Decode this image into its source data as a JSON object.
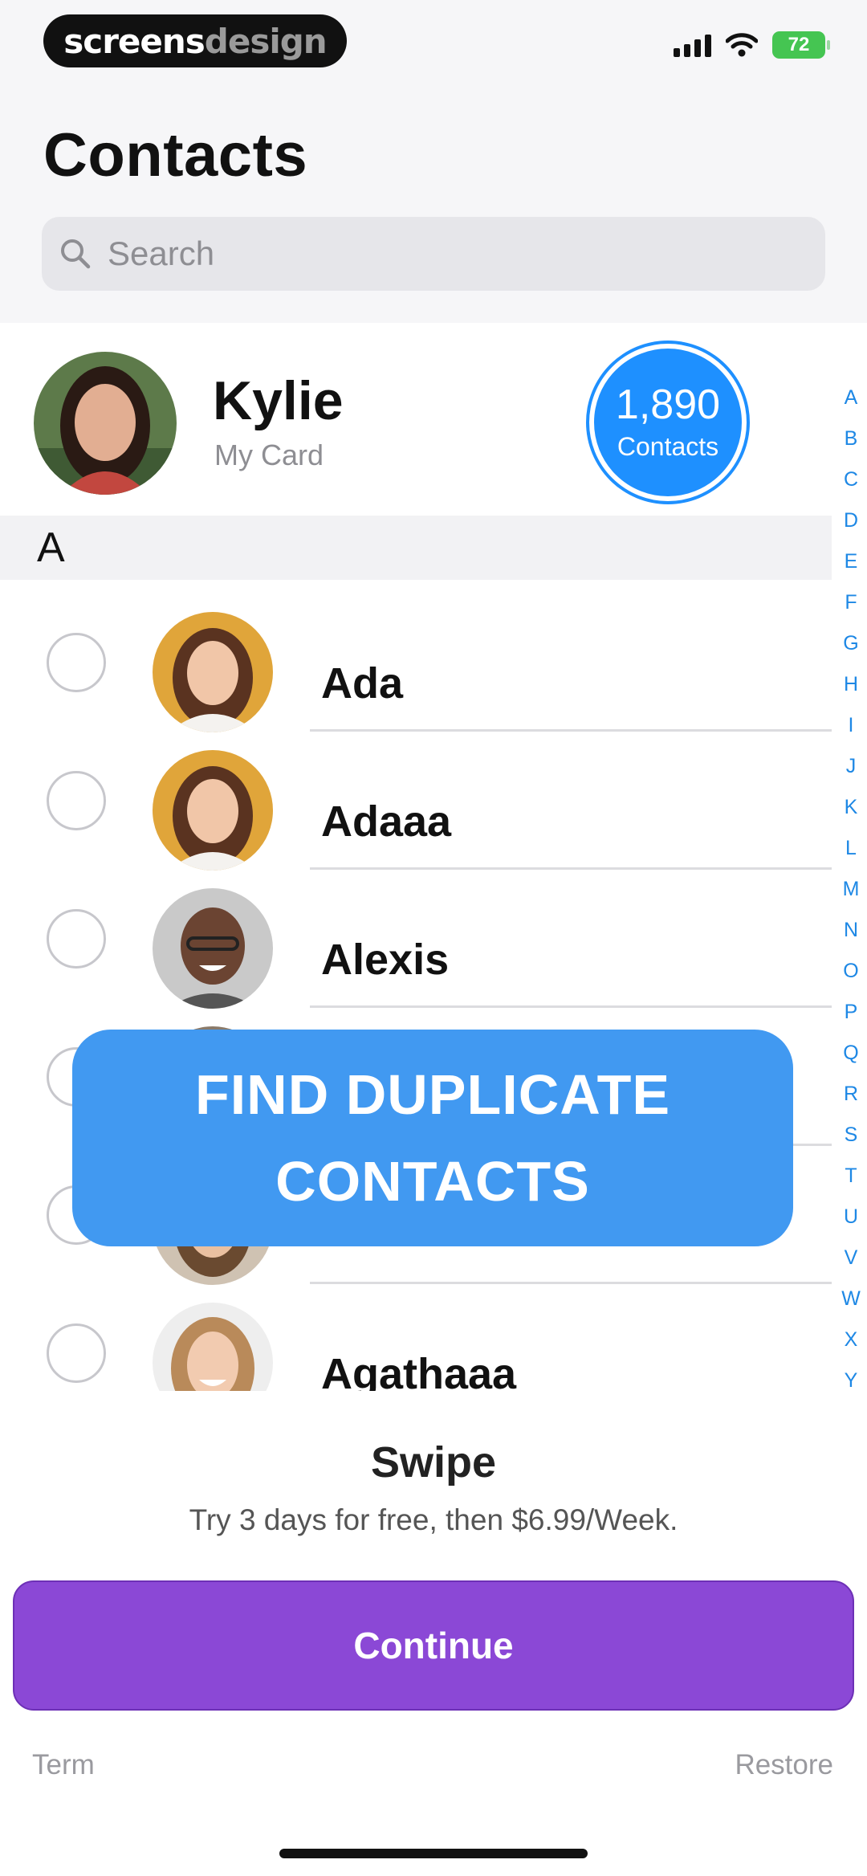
{
  "watermark": {
    "part1": "screens",
    "part2": "design"
  },
  "status_bar": {
    "battery": "72",
    "icons": [
      "cellular-signal-icon",
      "wifi-icon",
      "battery-icon"
    ]
  },
  "header": {
    "title": "Contacts"
  },
  "search": {
    "placeholder": "Search",
    "icon": "search-icon"
  },
  "my_card": {
    "name": "Kylie",
    "subtitle": "My Card",
    "count": "1,890",
    "count_label": "Contacts"
  },
  "section": {
    "letter": "A"
  },
  "contacts": [
    {
      "name": "Ada"
    },
    {
      "name": "Adaaa"
    },
    {
      "name": "Alexis"
    },
    {
      "name": ""
    },
    {
      "name": ""
    },
    {
      "name": "Agathaaa"
    }
  ],
  "alphabet": [
    "A",
    "B",
    "C",
    "D",
    "E",
    "F",
    "G",
    "H",
    "I",
    "J",
    "K",
    "L",
    "M",
    "N",
    "O",
    "P",
    "Q",
    "R",
    "S",
    "T",
    "U",
    "V",
    "W",
    "X",
    "Y"
  ],
  "banner": {
    "line1": "FIND DUPLICATE",
    "line2": "CONTACTS"
  },
  "paywall": {
    "title": "Swipe",
    "offer": "Try 3 days for free, then $6.99/Week.",
    "continue_label": "Continue",
    "term_label": "Term",
    "restore_label": "Restore"
  },
  "colors": {
    "accent_blue": "#1e90ff",
    "banner_blue": "#4199f1",
    "button_purple": "#8b48d6",
    "battery_green": "#45c552"
  }
}
